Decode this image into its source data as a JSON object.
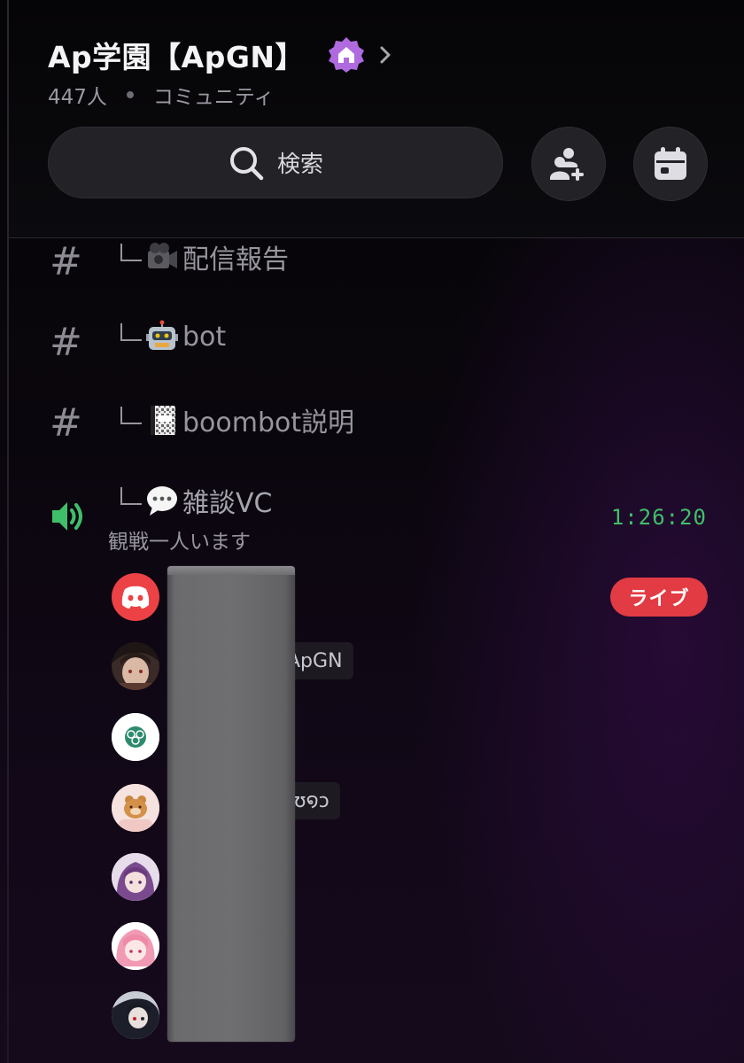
{
  "header": {
    "server_name": "Ap学園【ApGN】",
    "member_count": "447人",
    "server_type": "コミュニティ",
    "search_placeholder": "検索",
    "invite_icon": "add-user-icon",
    "events_icon": "calendar-icon",
    "boost_icon": "home-badge-icon",
    "chevron_icon": "chevron-right-icon"
  },
  "channels": [
    {
      "type": "text",
      "icon": "hash-icon",
      "emoji": "video-camera-emoji",
      "name": "配信報告"
    },
    {
      "type": "text",
      "icon": "hash-icon",
      "emoji": "robot-emoji",
      "name": "bot"
    },
    {
      "type": "text",
      "icon": "hash-icon",
      "emoji": "notebook-emoji",
      "name": "boombot説明"
    },
    {
      "type": "voice",
      "icon": "speaker-icon",
      "emoji": "speech-bubble-emoji",
      "name": "雑談VC",
      "status": "観戦一人います",
      "elapsed": "1:26:20"
    }
  ],
  "voice_participants": [
    {
      "avatar": "discord-logo-avatar",
      "badge": "ライブ"
    },
    {
      "avatar": "anime-boy-avatar",
      "name_tail": "ApGN"
    },
    {
      "avatar": "green-logo-avatar"
    },
    {
      "avatar": "bear-avatar",
      "name_tail": "ʊ໑ↄ"
    },
    {
      "avatar": "purple-hair-avatar"
    },
    {
      "avatar": "pink-hair-avatar"
    },
    {
      "avatar": "dark-hair-avatar"
    }
  ],
  "colors": {
    "voice_green": "#3fbf6a",
    "live_red": "#e23b43",
    "discord_red": "#ed4245",
    "boost_purple": "#b06ae0"
  }
}
